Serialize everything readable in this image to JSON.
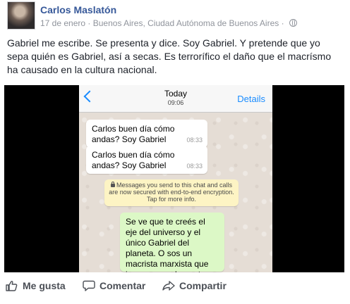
{
  "post": {
    "author": "Carlos Maslatón",
    "date": "17 de enero",
    "separator": "·",
    "location": "Buenos Aires, Ciudad Autónoma de Buenos Aires",
    "separator2": "·",
    "text": "Gabriel me escribe. Se presenta y dice. Soy Gabriel. Y pretende que yo sepa quién es Gabriel, así a secas. Es terrorífico el daño que el macrísmo ha causado en la cultura nacional."
  },
  "chat": {
    "header_title": "Today",
    "header_time": "09:06",
    "details_label": "Details",
    "messages": [
      {
        "text": "Carlos buen día cómo andas? Soy Gabriel",
        "time": "08:33"
      },
      {
        "text": "Carlos buen día cómo andas? Soy Gabriel",
        "time": "08:33"
      }
    ],
    "encryption_notice": "Messages you send to this chat and calls are now secured with end-to-end encryption. Tap for more info.",
    "sent_message": "Se ve que te creés el eje del universo y el único Gabriel del planeta. O sos un macrista marxista que ignora que a la gente se la identifica por el apellido."
  },
  "actions": {
    "like": "Me gusta",
    "comment": "Comentar",
    "share": "Compartir"
  },
  "colors": {
    "author_link": "#365899",
    "ios_blue": "#1a8cff",
    "sent_bubble": "#dcf8c6",
    "notice_bg": "#fdf4c4"
  },
  "icons": [
    "globe-icon",
    "back-chevron-icon",
    "lock-icon",
    "like-thumb-icon",
    "comment-icon",
    "share-icon"
  ]
}
